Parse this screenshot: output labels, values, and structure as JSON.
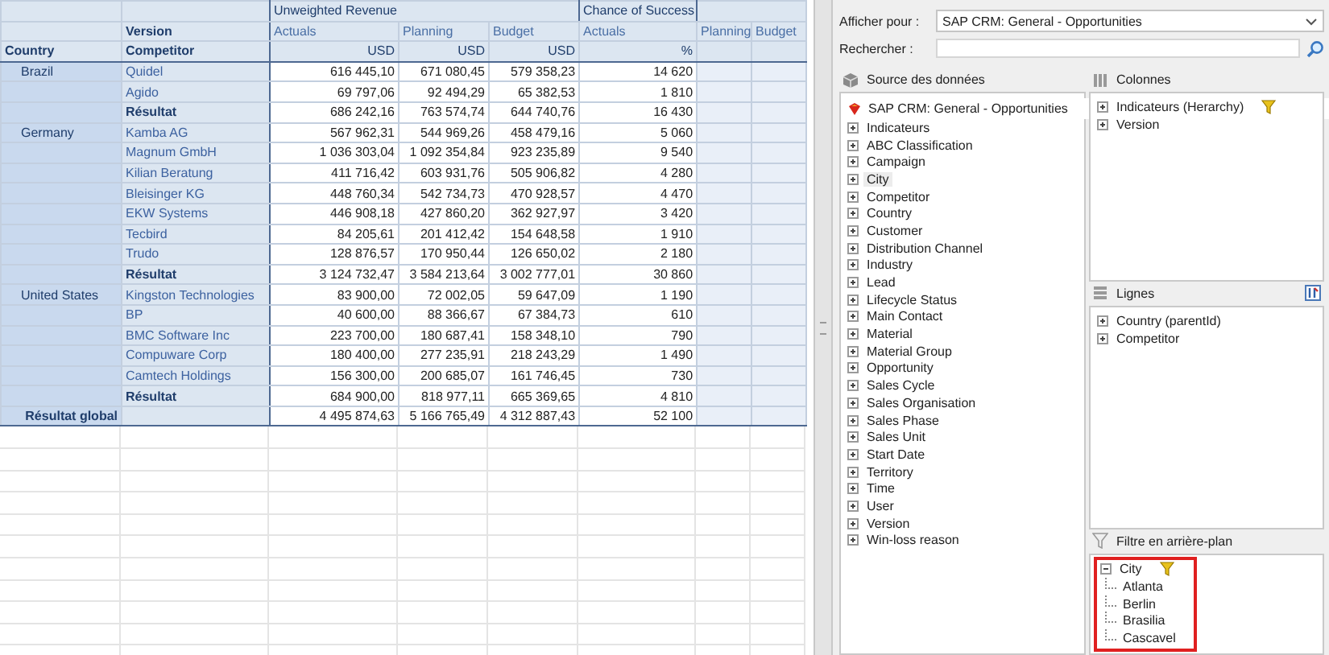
{
  "table": {
    "groups": [
      {
        "label": "Unweighted Revenue"
      },
      {
        "label": "Chance of Success"
      }
    ],
    "header": {
      "version_label": "Version",
      "country_label": "Country",
      "competitor_label": "Competitor"
    },
    "measures": [
      {
        "version": "Actuals",
        "unit": "USD"
      },
      {
        "version": "Planning",
        "unit": "USD"
      },
      {
        "version": "Budget",
        "unit": "USD"
      },
      {
        "version": "Actuals",
        "unit": "%"
      },
      {
        "version": "Planning"
      },
      {
        "version": "Budget"
      }
    ],
    "rows": [
      {
        "kind": "item",
        "country": "Brazil",
        "label": "Quidel",
        "values": [
          "616 445,10",
          "671 080,45",
          "579 358,23",
          "14 620"
        ]
      },
      {
        "kind": "item",
        "label": "Agido",
        "values": [
          "69 797,06",
          "92 494,29",
          "65 382,53",
          "1 810"
        ]
      },
      {
        "kind": "subtotal",
        "label": "Résultat",
        "values": [
          "686 242,16",
          "763 574,74",
          "644 740,76",
          "16 430"
        ]
      },
      {
        "kind": "item",
        "country": "Germany",
        "label": "Kamba AG",
        "values": [
          "567 962,31",
          "544 969,26",
          "458 479,16",
          "5 060"
        ]
      },
      {
        "kind": "item",
        "label": "Magnum GmbH",
        "values": [
          "1 036 303,04",
          "1 092 354,84",
          "923 235,89",
          "9 540"
        ]
      },
      {
        "kind": "item",
        "label": "Kilian Beratung",
        "values": [
          "411 716,42",
          "603 931,76",
          "505 906,82",
          "4 280"
        ]
      },
      {
        "kind": "item",
        "label": "Bleisinger KG",
        "values": [
          "448 760,34",
          "542 734,73",
          "470 928,57",
          "4 470"
        ]
      },
      {
        "kind": "item",
        "label": "EKW Systems",
        "values": [
          "446 908,18",
          "427 860,20",
          "362 927,97",
          "3 420"
        ]
      },
      {
        "kind": "item",
        "label": "Tecbird",
        "values": [
          "84 205,61",
          "201 412,42",
          "154 648,58",
          "1 910"
        ]
      },
      {
        "kind": "item",
        "label": "Trudo",
        "values": [
          "128 876,57",
          "170 950,44",
          "126 650,02",
          "2 180"
        ]
      },
      {
        "kind": "subtotal",
        "label": "Résultat",
        "values": [
          "3 124 732,47",
          "3 584 213,64",
          "3 002 777,01",
          "30 860"
        ]
      },
      {
        "kind": "item",
        "country": "United States",
        "label": "Kingston Technologies",
        "values": [
          "83 900,00",
          "72 002,05",
          "59 647,09",
          "1 190"
        ]
      },
      {
        "kind": "item",
        "label": "BP",
        "values": [
          "40 600,00",
          "88 366,67",
          "67 384,73",
          "610"
        ]
      },
      {
        "kind": "item",
        "label": "BMC Software Inc",
        "values": [
          "223 700,00",
          "180 687,41",
          "158 348,10",
          "790"
        ]
      },
      {
        "kind": "item",
        "label": "Compuware Corp",
        "values": [
          "180 400,00",
          "277 235,91",
          "218 243,29",
          "1 490"
        ]
      },
      {
        "kind": "item",
        "label": "Camtech Holdings",
        "values": [
          "156 300,00",
          "200 685,07",
          "161 746,45",
          "730"
        ]
      },
      {
        "kind": "subtotal",
        "label": "Résultat",
        "values": [
          "684 900,00",
          "818 977,11",
          "665 369,65",
          "4 810"
        ]
      },
      {
        "kind": "total",
        "label": "Résultat global",
        "values": [
          "4 495 874,63",
          "5 166 765,49",
          "4 312 887,43",
          "52 100"
        ]
      }
    ]
  },
  "panel": {
    "display_for": {
      "label": "Afficher pour :",
      "value": "SAP CRM: General - Opportunities"
    },
    "search": {
      "label": "Rechercher :"
    },
    "source": {
      "title": "Source des données",
      "root": "SAP CRM: General - Opportunities",
      "items": [
        {
          "label": "Indicateurs",
          "selected": false
        },
        {
          "label": "ABC Classification",
          "selected": false
        },
        {
          "label": "Campaign",
          "selected": false
        },
        {
          "label": "City",
          "selected": true
        },
        {
          "label": "Competitor",
          "selected": false
        },
        {
          "label": "Country",
          "selected": false
        },
        {
          "label": "Customer",
          "selected": false
        },
        {
          "label": "Distribution Channel",
          "selected": false
        },
        {
          "label": "Industry",
          "selected": false
        },
        {
          "label": "Lead",
          "selected": false
        },
        {
          "label": "Lifecycle Status",
          "selected": false
        },
        {
          "label": "Main Contact",
          "selected": false
        },
        {
          "label": "Material",
          "selected": false
        },
        {
          "label": "Material Group",
          "selected": false
        },
        {
          "label": "Opportunity",
          "selected": false
        },
        {
          "label": "Sales Cycle",
          "selected": false
        },
        {
          "label": "Sales Organisation",
          "selected": false
        },
        {
          "label": "Sales Phase",
          "selected": false
        },
        {
          "label": "Sales Unit",
          "selected": false
        },
        {
          "label": "Start Date",
          "selected": false
        },
        {
          "label": "Territory",
          "selected": false
        },
        {
          "label": "Time",
          "selected": false
        },
        {
          "label": "User",
          "selected": false
        },
        {
          "label": "Version",
          "selected": false
        },
        {
          "label": "Win-loss reason",
          "selected": false
        }
      ]
    },
    "columns": {
      "title": "Colonnes",
      "items": [
        {
          "label": "Indicateurs (Herarchy)",
          "filter": true
        },
        {
          "label": "Version",
          "filter": false
        }
      ]
    },
    "rows": {
      "title": "Lignes",
      "items": [
        {
          "label": "Country (parentId)",
          "filter": false
        },
        {
          "label": "Competitor",
          "filter": false
        }
      ]
    },
    "background_filter": {
      "title": "Filtre en arrière-plan",
      "items": [
        {
          "label": "City",
          "filter": true,
          "expanded": true,
          "children": [
            {
              "label": "Atlanta"
            },
            {
              "label": "Berlin"
            },
            {
              "label": "Brasilia"
            },
            {
              "label": "Cascavel"
            }
          ]
        }
      ]
    }
  }
}
